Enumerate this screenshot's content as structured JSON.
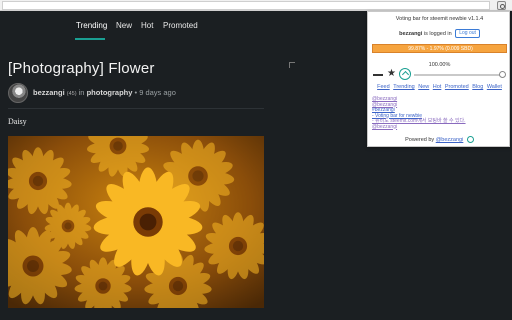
{
  "nav": {
    "items": [
      "Trending",
      "New",
      "Hot",
      "Promoted"
    ]
  },
  "post": {
    "title": "[Photography] Flower",
    "author": "bezzangi",
    "reputation": "(45)",
    "in_label": "in",
    "category": "photography",
    "age": "• 9 days ago",
    "body": "Daisy",
    "image_alt": "Yellow daisies"
  },
  "popup": {
    "title": "Voting bar for steemit newbie v1.1.4",
    "login_user": "bezzangi",
    "login_text": "is logged in",
    "logout_label": "Log out",
    "vp_text": "99.87% - 1.97% (0.009 SBD)",
    "vp_fraction": 0.9987,
    "vote_percent": "100.00%",
    "links": [
      "Feed",
      "Trending",
      "New",
      "Hot",
      "Promoted",
      "Blog",
      "Wallet"
    ],
    "lines": [
      "@bezzangi",
      "@bezzangi",
      "#bezzangi",
      "- Voting bar for newbie",
      "- 뉴비도 steemit.com에서 보팅바 쓸 수 있다.",
      "@bezzangi"
    ],
    "powered_label": "Powered by",
    "powered_link": "@bezzangi"
  },
  "colors": {
    "accent": "#1a9f92",
    "vp_bar": "#f39b33",
    "link": "#3b63c7"
  }
}
